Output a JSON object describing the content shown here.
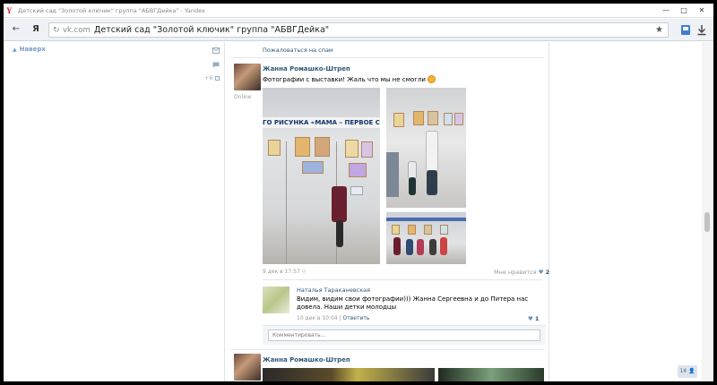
{
  "browser": {
    "tab_title": "Детский сад \"Золотой ключик\" группа \"АБВГДейка\" - Yandex",
    "back_glyph": "←",
    "yandex_glyph": "Я",
    "minimize": "—",
    "maximize": "□",
    "close": "✕",
    "url_domain": "vk.com",
    "url_title": "Детский сад \"Золотой ключик\" группа \"АБВГДейка\"",
    "reload_glyph": "↻",
    "star_glyph": "★"
  },
  "left": {
    "up_label": "Наверх",
    "up_glyph": "▲",
    "count_label": "+6"
  },
  "wall": {
    "report_spam": "Пожаловаться на спам",
    "post1": {
      "author": "Жанна Ромашко-Штреп",
      "status": "Online",
      "text": "Фотографии с выставки! Жаль что мы не смогли",
      "banner": "ГО РИСУНКА «МАМА – ПЕРВОЕ СЛОВ",
      "date": "9 дек в 17:57",
      "like_label": "Мне нравится",
      "like_count": "2",
      "heart": "♥"
    },
    "comment": {
      "author": "Наталья Тараканевская",
      "text": "Видим, видим свои фотографии))) Жанна Сергеевна и до Питера нас довела. Наши детки молодцы",
      "date": "10 дек в 10:04",
      "divider": "|",
      "reply": "Ответить",
      "like_count": "1",
      "heart": "♥"
    },
    "comment_placeholder": "Комментировать...",
    "post2": {
      "author": "Жанна Ромашко-Штреп"
    }
  },
  "right": {
    "friends_count": "14"
  },
  "colors": {
    "link": "#2b587a",
    "muted": "#999999",
    "border": "#dfe4ea",
    "yandex_red": "#e0201b"
  }
}
